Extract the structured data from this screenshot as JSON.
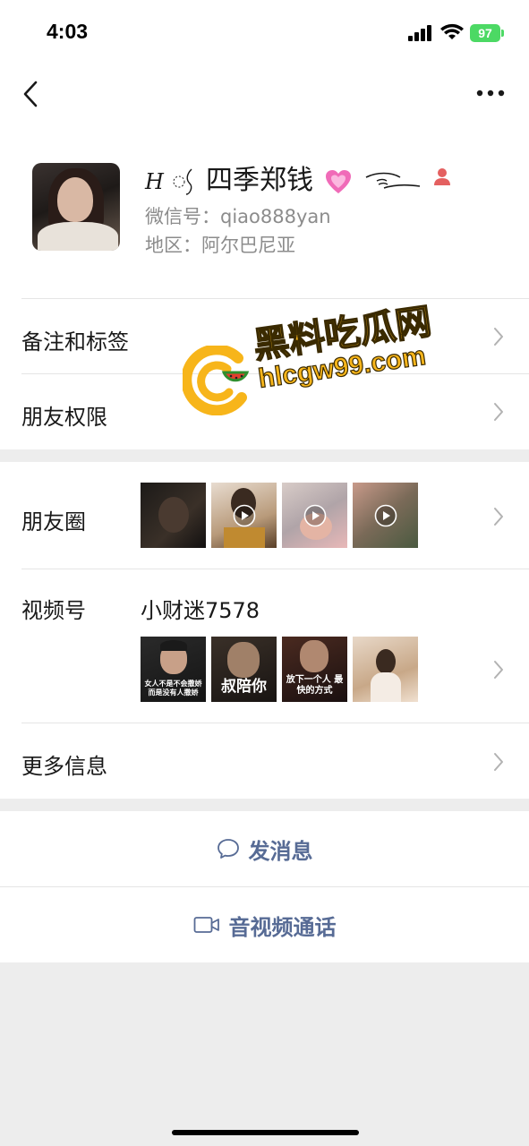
{
  "status_bar": {
    "time": "4:03",
    "battery": "97"
  },
  "profile": {
    "name_prefix": "H",
    "name": "四季郑钱",
    "wechat_id": "微信号：qiao888yan",
    "region": "地区：阿尔巴尼亚"
  },
  "rows": {
    "remarks": "备注和标签",
    "permissions": "朋友权限",
    "moments": "朋友圈",
    "channels": "视频号",
    "channels_name": "小财迷7578",
    "more_info": "更多信息"
  },
  "channel_thumbs": {
    "t1": "女人不是不会撒娇 而是没有人撒娇",
    "t2": "叔陪你",
    "t3": "放下一个人 最快的方式"
  },
  "actions": {
    "message": "发消息",
    "video_call": "音视频通话"
  },
  "watermark": {
    "title": "黑料吃瓜网",
    "url": "hlcgw99.com"
  },
  "colors": {
    "link_blue": "#576b95",
    "background": "#ededed",
    "watermark_yellow": "#f7b51a"
  }
}
